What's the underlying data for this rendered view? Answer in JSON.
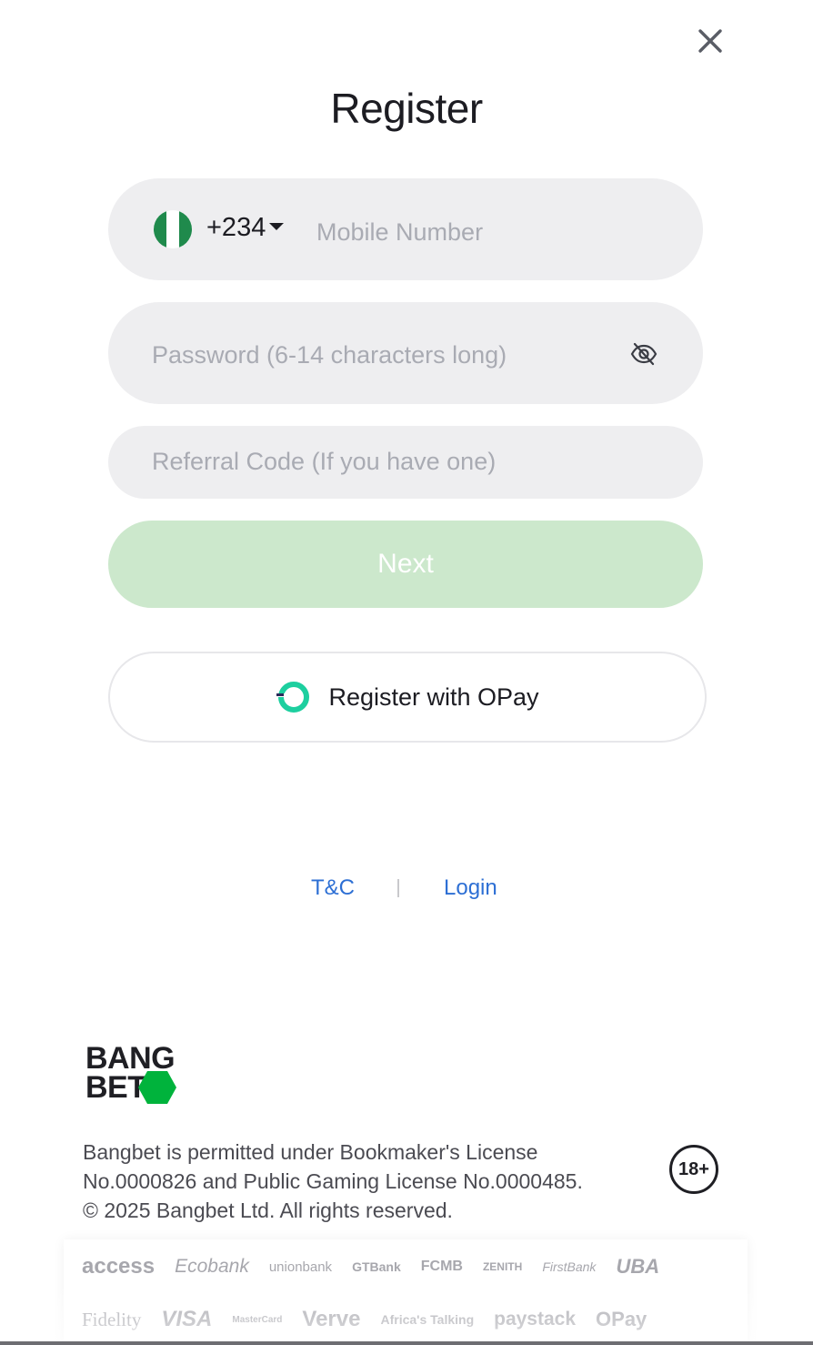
{
  "title": "Register",
  "phone": {
    "country_code": "+234",
    "placeholder": "Mobile Number"
  },
  "password": {
    "placeholder": "Password (6-14 characters long)"
  },
  "referral": {
    "placeholder": "Referral Code (If you have one)"
  },
  "next_label": "Next",
  "opay_label": "Register with OPay",
  "links": {
    "terms": "T&C",
    "login": "Login"
  },
  "brand": {
    "line1": "BANG",
    "line2": "BET"
  },
  "footer": {
    "license_line1": "Bangbet is permitted under Bookmaker's License",
    "license_line2": "No.0000826 and Public Gaming License No.0000485.",
    "copyright": "© 2025 Bangbet Ltd. All rights reserved.",
    "age_badge": "18+"
  },
  "partners_row1": [
    "access",
    "Ecobank",
    "unionbank",
    "GTBank",
    "FCMB",
    "ZENITH",
    "FirstBank",
    "UBA"
  ],
  "partners_row2": [
    "Fidelity",
    "VISA",
    "MasterCard",
    "Verve",
    "Africa's Talking",
    "paystack",
    "OPay"
  ],
  "colors": {
    "accent_green": "#00b33c",
    "next_disabled": "#cce8cc",
    "link_blue": "#2d6fd4",
    "field_bg": "#eeeef0"
  }
}
